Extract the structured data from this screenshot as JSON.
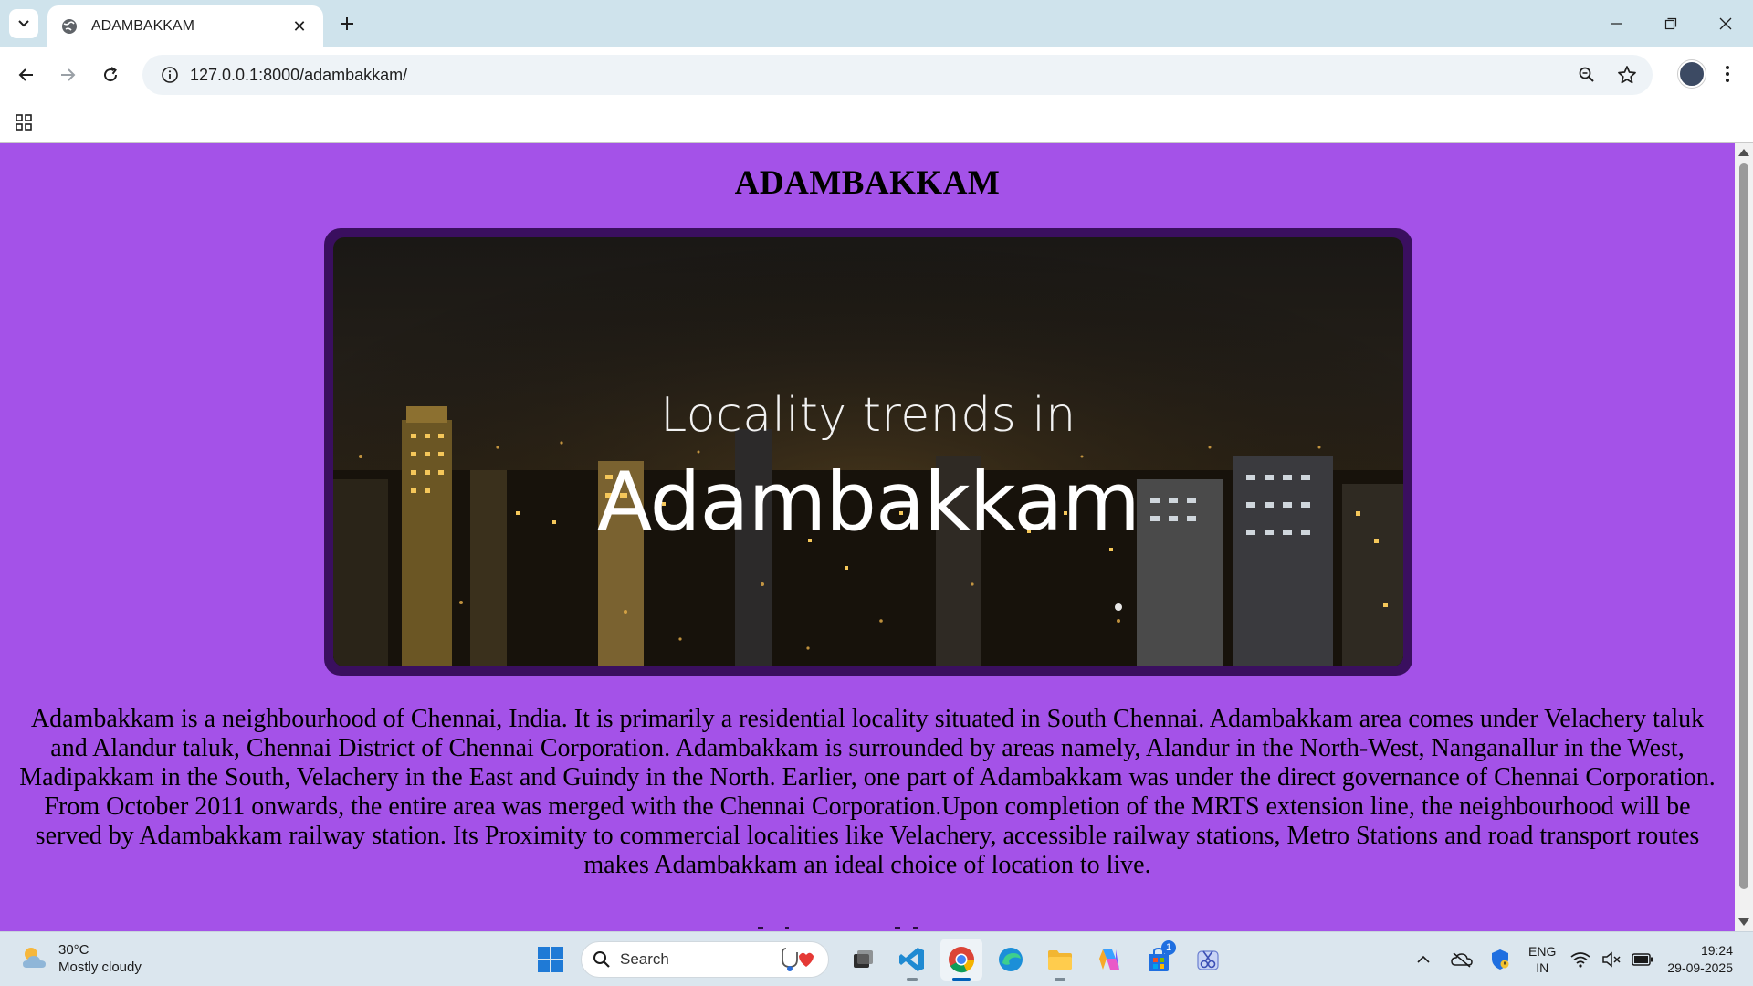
{
  "browser": {
    "tab": {
      "title": "ADAMBAKKAM"
    },
    "address_bar": {
      "url": "127.0.0.1:8000/adambakkam/"
    }
  },
  "page": {
    "title": "ADAMBAKKAM",
    "hero": {
      "line1": "Locality trends in",
      "line2": "Adambakkam"
    },
    "description": "Adambakkam is a neighbourhood of Chennai, India. It is primarily a residential locality situated in South Chennai. Adambakkam area comes under Velachery taluk and Alandur taluk, Chennai District of Chennai Corporation. Adambakkam is surrounded by areas namely, Alandur in the North-West, Nanganallur in the West, Madipakkam in the South, Velachery in the East and Guindy in the North. Earlier, one part of Adambakkam was under the direct governance of Chennai Corporation. From October 2011 onwards, the entire area was merged with the Chennai Corporation.Upon completion of the MRTS extension line, the neighbourhood will be served by Adambakkam railway station. Its Proximity to commercial localities like Velachery, accessible railway stations, Metro Stations and road transport routes makes Adambakkam an ideal choice of location to live.",
    "background_color": "#a452e8",
    "frame_color": "#3a0f5f"
  },
  "taskbar": {
    "weather": {
      "temp": "30°C",
      "condition": "Mostly cloudy"
    },
    "search_placeholder": "Search",
    "store_badge": "1",
    "language": {
      "line1": "ENG",
      "line2": "IN"
    },
    "clock": {
      "time": "19:24",
      "date": "29-09-2025"
    }
  }
}
